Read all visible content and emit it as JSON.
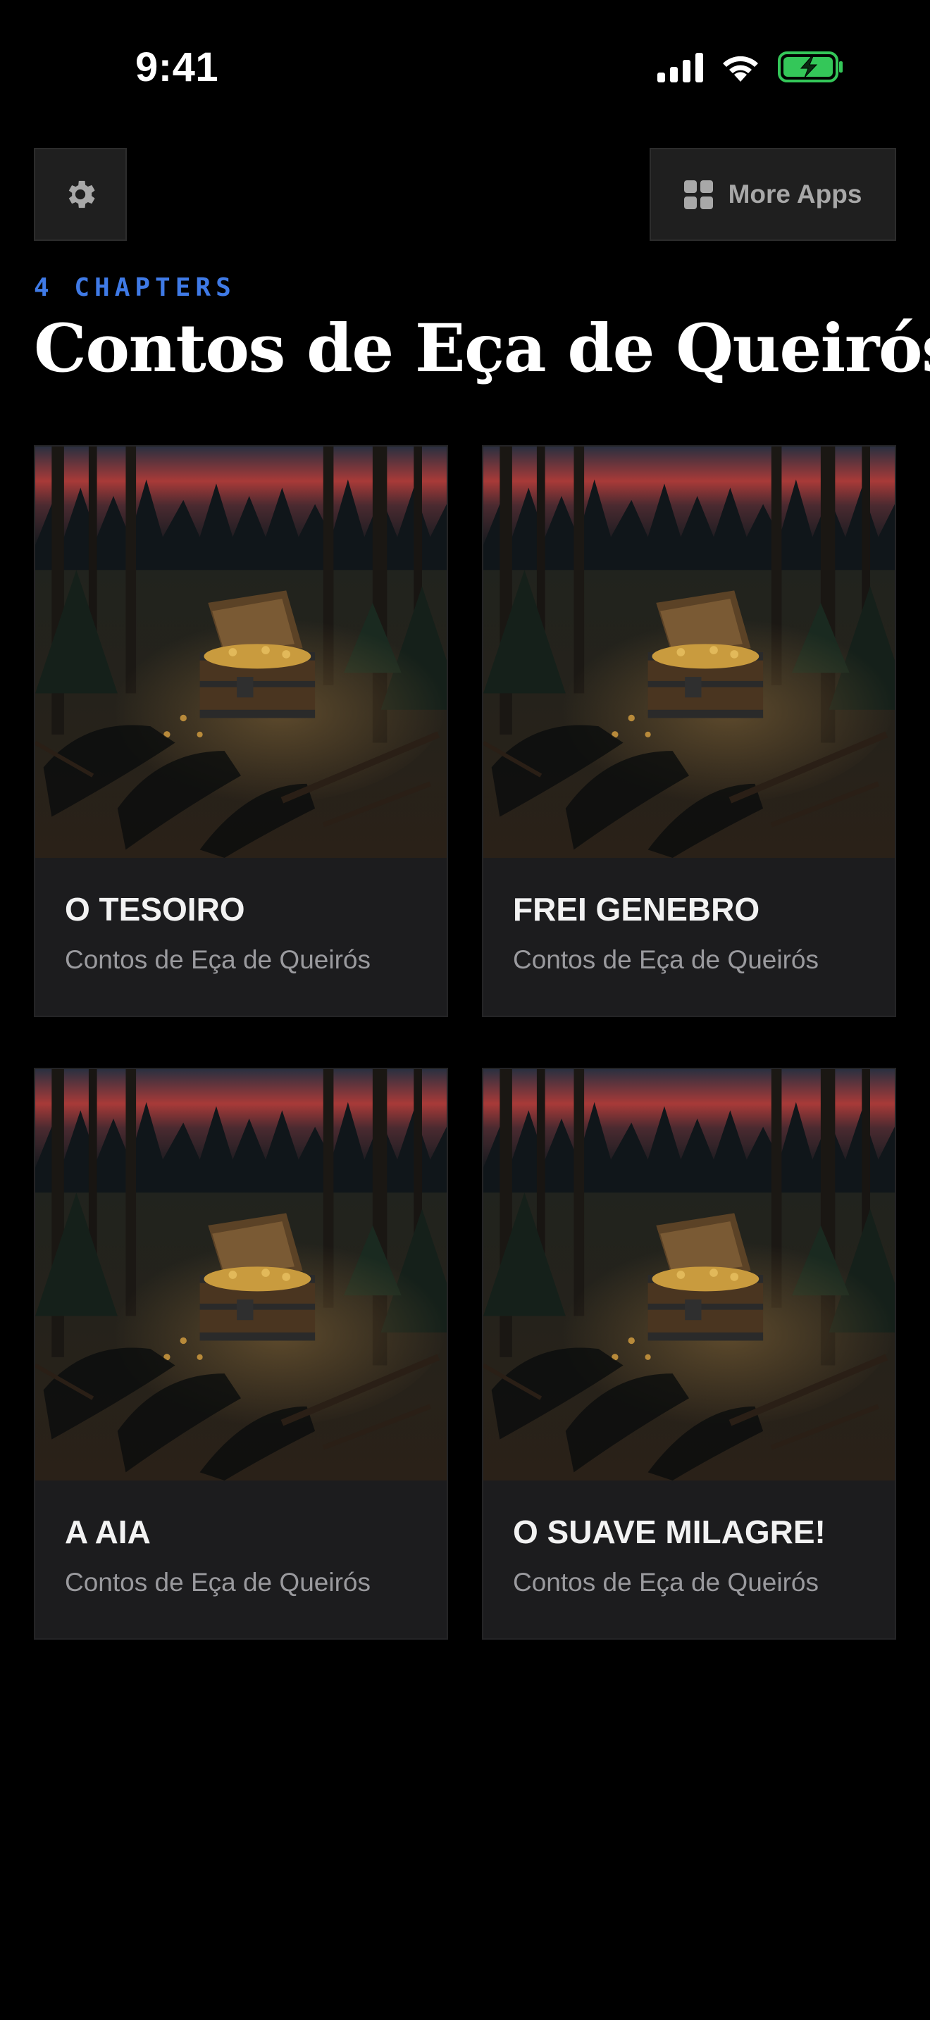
{
  "status_bar": {
    "time": "9:41",
    "icons": [
      "cellular-signal-icon",
      "wifi-icon",
      "battery-charging-icon"
    ],
    "battery_color": "#34c759"
  },
  "toolbar": {
    "settings_icon": "gear-icon",
    "more_apps_icon": "grid-icon",
    "more_apps_label": "More Apps"
  },
  "header": {
    "chapter_count": "4 CHAPTERS",
    "title": "Contos de Eça de Queirós",
    "accent_color": "#3f7ae6"
  },
  "chapters": [
    {
      "title": "O TESOIRO",
      "subtitle": "Contos de Eça de Queirós",
      "image": "forest-treasure-chest-illustration"
    },
    {
      "title": "FREI GENEBRO",
      "subtitle": "Contos de Eça de Queirós",
      "image": "forest-treasure-chest-illustration"
    },
    {
      "title": "A AIA",
      "subtitle": "Contos de Eça de Queirós",
      "image": "forest-treasure-chest-illustration"
    },
    {
      "title": "O SUAVE MILAGRE!",
      "subtitle": "Contos de Eça de Queirós",
      "image": "forest-treasure-chest-illustration"
    }
  ]
}
